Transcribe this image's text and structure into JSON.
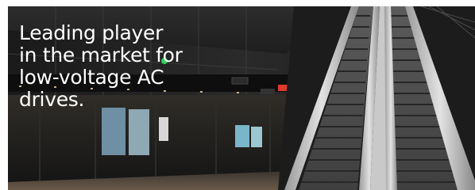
{
  "banner": {
    "headline_lines": [
      "Leading player",
      "in the market for",
      "low-voltage AC",
      "drives."
    ],
    "photo_subject": "metro-station-escalators"
  },
  "colors": {
    "headline_text": "#ffffff",
    "photo_dark": "#131313",
    "escalator_steel": "#b8b8b8",
    "sign_red": "#e03a2a",
    "lamp_green": "#2fd05a"
  }
}
